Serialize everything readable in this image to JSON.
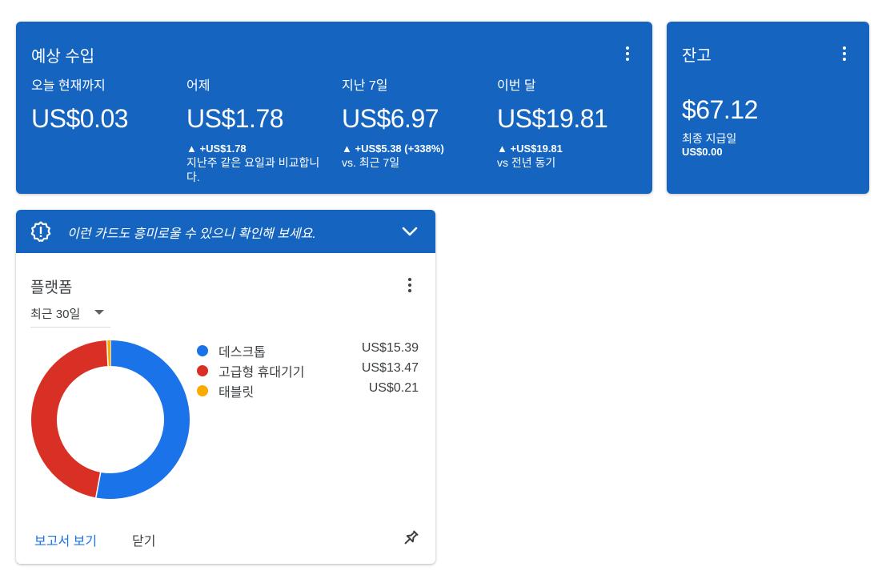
{
  "earnings": {
    "title": "예상 수입",
    "metrics": [
      {
        "label": "오늘 현재까지",
        "value": "US$0.03",
        "delta": "",
        "note": ""
      },
      {
        "label": "어제",
        "value": "US$1.78",
        "delta": "▲ +US$1.78",
        "note": "지난주 같은 요일과 비교합니다."
      },
      {
        "label": "지난 7일",
        "value": "US$6.97",
        "delta": "▲ +US$5.38 (+338%)",
        "note": "vs. 최근 7일"
      },
      {
        "label": "이번 달",
        "value": "US$19.81",
        "delta": "▲ +US$19.81",
        "note": "vs 전년 동기"
      }
    ]
  },
  "balance": {
    "title": "잔고",
    "value": "$67.12",
    "last_payment_label": "최종 지급일",
    "last_payment_value": "US$0.00"
  },
  "platform_card": {
    "banner_text": "이런 카드도 흥미로울 수 있으니 확인해 보세요.",
    "title": "플랫폼",
    "date_range": "최근 30일",
    "view_report_label": "보고서 보기",
    "close_label": "닫기"
  },
  "chart_data": {
    "type": "pie",
    "title": "",
    "categories": [
      "데스크톱",
      "고급형 휴대기기",
      "태블릿"
    ],
    "values": [
      15.39,
      13.47,
      0.21
    ],
    "value_labels": [
      "US$15.39",
      "US$13.47",
      "US$0.21"
    ],
    "colors": [
      "#1a73e8",
      "#d93025",
      "#f9ab00"
    ],
    "style": "donut",
    "legend_position": "right"
  },
  "icons": {
    "banner": "alert-badge-icon",
    "expand": "chevron-down-icon",
    "menu": "more-vert-icon",
    "pin": "pin-icon"
  }
}
